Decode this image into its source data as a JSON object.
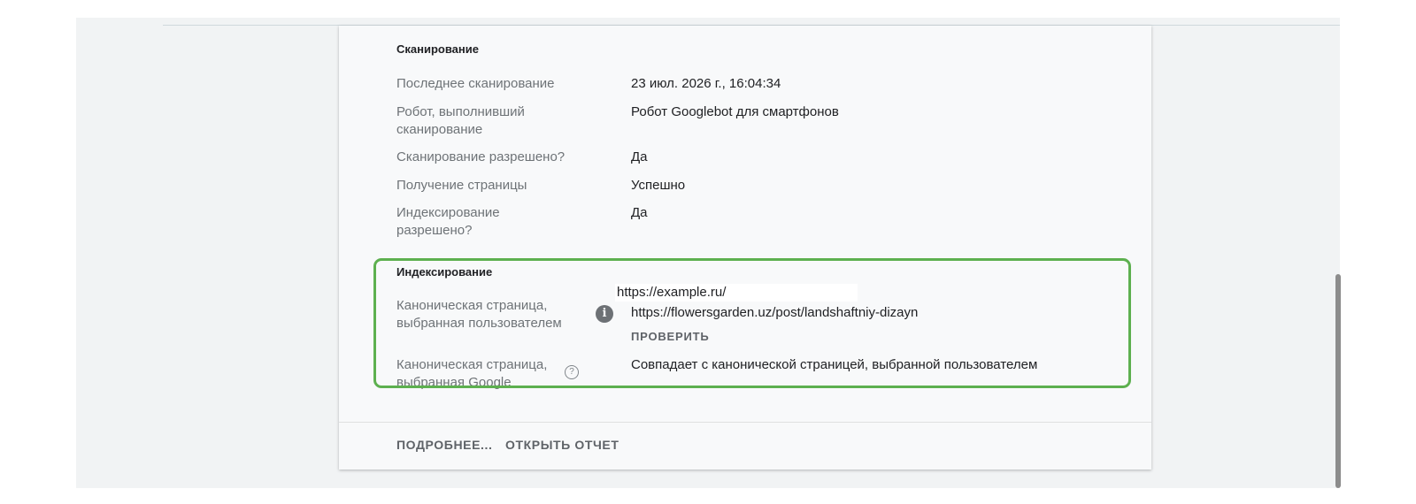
{
  "crawl": {
    "title": "Сканирование",
    "rows": [
      {
        "label": "Последнее сканирование",
        "value": "23 июл. 2026 г., 16:04:34"
      },
      {
        "label": "Робот, выполнивший сканирование",
        "value": "Робот Googlebot для смартфонов"
      },
      {
        "label": "Сканирование разрешено?",
        "value": "Да"
      },
      {
        "label": "Получение страницы",
        "value": "Успешно"
      },
      {
        "label": "Индексирование разрешено?",
        "value": "Да"
      }
    ]
  },
  "indexing": {
    "title": "Индексирование",
    "user_canonical_label": "Каноническая страница, выбранная пользователем",
    "user_canonical_value": "https://flowersgarden.uz/post/landshaftniy-dizayn",
    "overlay_url": "https://example.ru/",
    "check_label": "ПРОВЕРИТЬ",
    "google_canonical_label": "Каноническая страница, выбранная Google",
    "google_canonical_value": "Совпадает с канонической страницей, выбранной пользователем"
  },
  "footer": {
    "more_label": "ПОДРОБНЕЕ...",
    "open_report_label": "ОТКРЫТЬ ОТЧЕТ"
  },
  "icons": {
    "info": "info-icon",
    "help": "help-circle-icon"
  },
  "colors": {
    "highlight": "#5db04f",
    "panel": "#f8f9fa",
    "background": "#f1f3f4"
  }
}
